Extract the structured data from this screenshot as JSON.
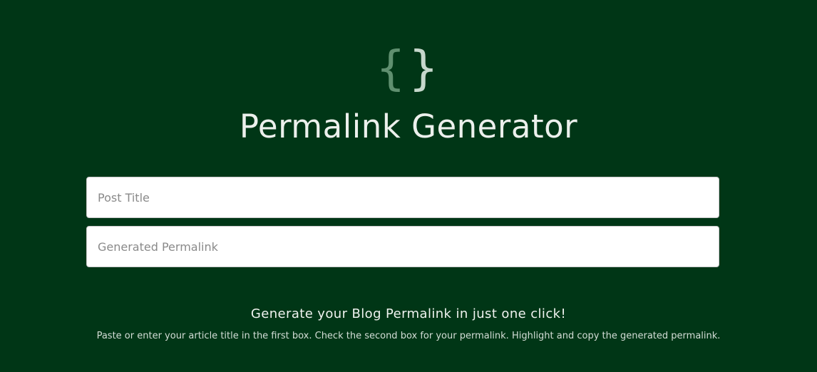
{
  "logo": {
    "left_brace": "{",
    "right_brace": "}",
    "icon": "curly-braces-icon",
    "colors": {
      "left": "#5f8f6f",
      "right": "#c6d8cc"
    }
  },
  "header": {
    "title": "Permalink Generator"
  },
  "form": {
    "post_title": {
      "value": "",
      "placeholder": "Post Title"
    },
    "generated_permalink": {
      "value": "",
      "placeholder": "Generated Permalink"
    }
  },
  "footer": {
    "tagline": "Generate your Blog Permalink in just one click!",
    "instructions": "Paste or enter your article title in the first box. Check the second box for your permalink. Highlight and copy the generated permalink."
  },
  "theme": {
    "background": "#003616",
    "text": "#ecf0ec"
  }
}
